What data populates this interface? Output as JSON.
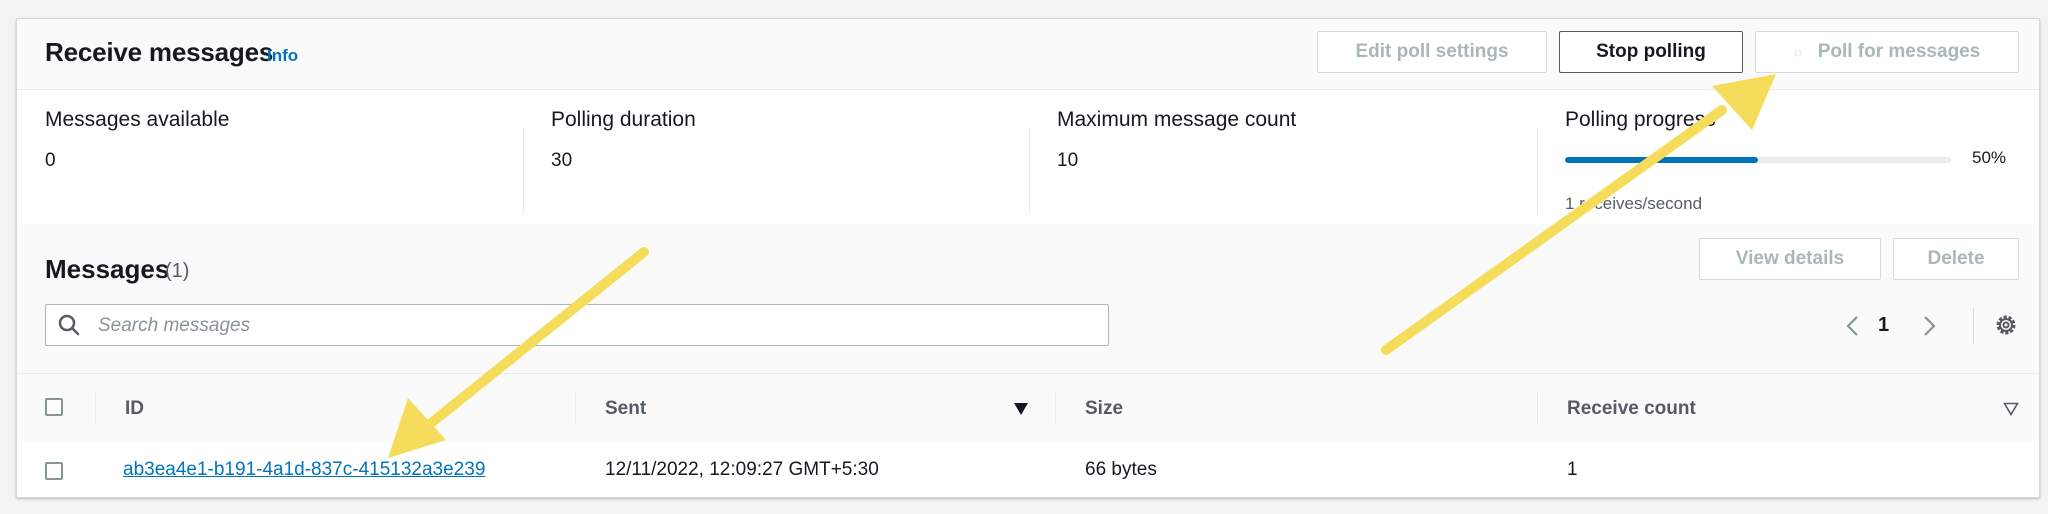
{
  "header": {
    "title": "Receive messages",
    "info": "Info",
    "edit_poll_settings": "Edit poll settings",
    "stop_polling": "Stop polling",
    "poll_for_messages": "Poll for messages"
  },
  "stats": {
    "messages_available": {
      "label": "Messages available",
      "value": "0"
    },
    "polling_duration": {
      "label": "Polling duration",
      "value": "30"
    },
    "maximum_message_count": {
      "label": "Maximum message count",
      "value": "10"
    },
    "polling_progress": {
      "label": "Polling progress",
      "percent_text": "50%",
      "percent": 50,
      "rate": "1 receives/second"
    }
  },
  "messages": {
    "title": "Messages",
    "count": "(1)",
    "view_details": "View details",
    "delete": "Delete",
    "search_placeholder": "Search messages",
    "page": "1",
    "columns": [
      "ID",
      "Sent",
      "Size",
      "Receive count"
    ],
    "rows": [
      {
        "id": "ab3ea4e1-b191-4a1d-837c-415132a3e239",
        "sent": "12/11/2022, 12:09:27 GMT+5:30",
        "size": "66 bytes",
        "receive_count": "1"
      }
    ]
  },
  "colors": {
    "accent": "#0073bb",
    "annotation_arrow": "#f5dc5a",
    "disabled_text": "#aab7b8"
  }
}
